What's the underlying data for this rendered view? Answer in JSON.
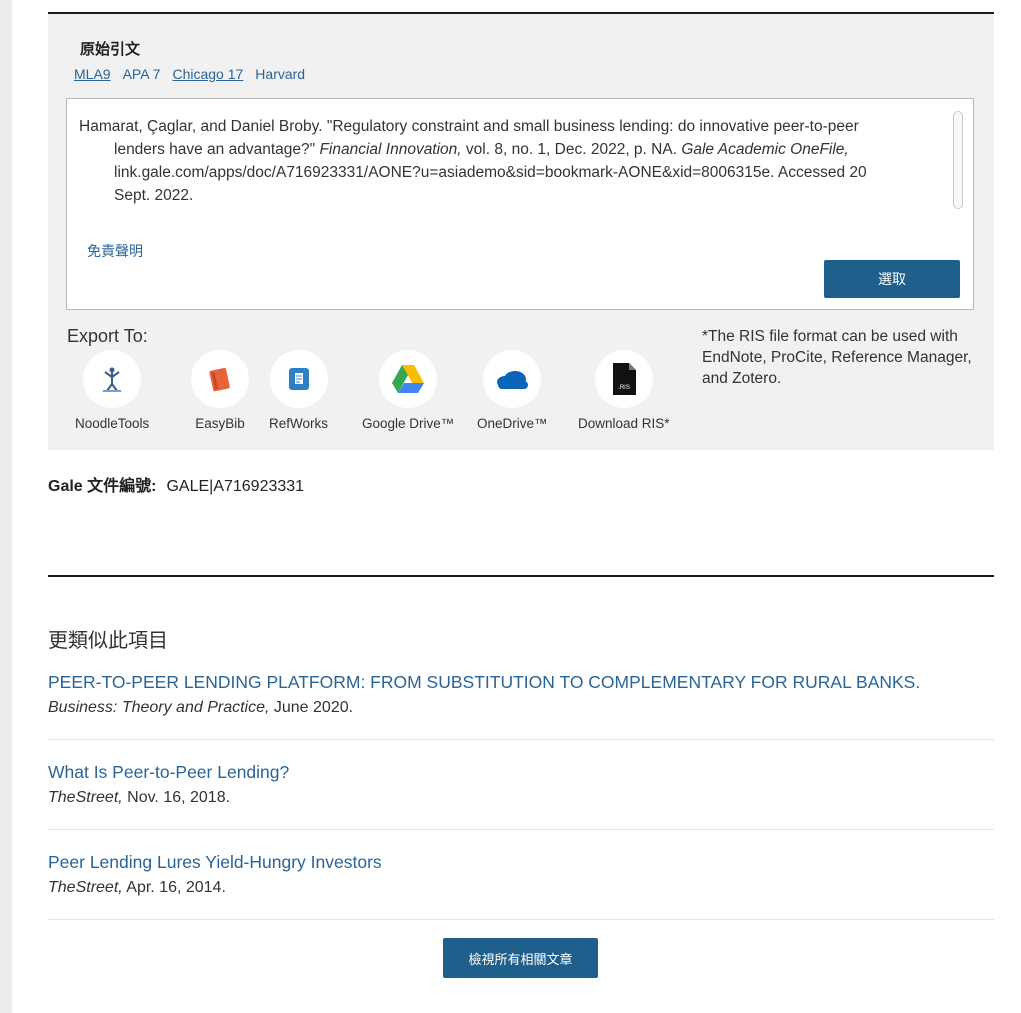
{
  "citation": {
    "heading": "原始引文",
    "styles": [
      {
        "label": "MLA9",
        "underline": true
      },
      {
        "label": "APA 7",
        "underline": false
      },
      {
        "label": "Chicago 17",
        "underline": true
      },
      {
        "label": "Harvard",
        "underline": false
      }
    ],
    "text_part1": "Hamarat, Çaglar, and Daniel Broby. \"Regulatory constraint and small business lending: do innovative peer-to-peer lenders have an advantage?\" ",
    "journal": "Financial Innovation,",
    "text_part2": " vol. 8, no. 1, Dec. 2022, p. NA. ",
    "database": "Gale Academic OneFile,",
    "text_part3": " link.gale.com/apps/doc/A716923331/AONE?u=asiademo&sid=bookmark-AONE&xid=8006315e. Accessed 20 Sept. 2022.",
    "disclaimer": "免責聲明",
    "select_label": "選取"
  },
  "export": {
    "label": "Export To:",
    "ris_note": "*The RIS file format can be used with EndNote, ProCite, Reference Manager, and Zotero.",
    "items": [
      {
        "name": "NoodleTools",
        "icon": "noodletools-icon"
      },
      {
        "name": "EasyBib",
        "icon": "easybib-icon"
      },
      {
        "name": "RefWorks",
        "icon": "refworks-icon"
      },
      {
        "name": "Google Drive™",
        "icon": "google-drive-icon"
      },
      {
        "name": "OneDrive™",
        "icon": "onedrive-icon"
      },
      {
        "name": "Download RIS*",
        "icon": "ris-file-icon"
      }
    ]
  },
  "gale_doc": {
    "label": "Gale 文件編號:",
    "value": "GALE|A716923331"
  },
  "more_like_this": {
    "title": "更類似此項目",
    "items": [
      {
        "title": "PEER-TO-PEER LENDING PLATFORM: FROM SUBSTITUTION TO COMPLEMENTARY FOR RURAL BANKS.",
        "source": "Business: Theory and Practice,",
        "date": " June 2020."
      },
      {
        "title": "What Is Peer-to-Peer Lending?",
        "source": "TheStreet,",
        "date": " Nov. 16, 2018."
      },
      {
        "title": "Peer Lending Lures Yield-Hungry Investors",
        "source": "TheStreet,",
        "date": " Apr. 16, 2014."
      }
    ],
    "view_all_label": "檢視所有相關文章"
  },
  "colors": {
    "link": "#2a6496",
    "button": "#1f5f8b",
    "panel": "#f1f1f1"
  }
}
